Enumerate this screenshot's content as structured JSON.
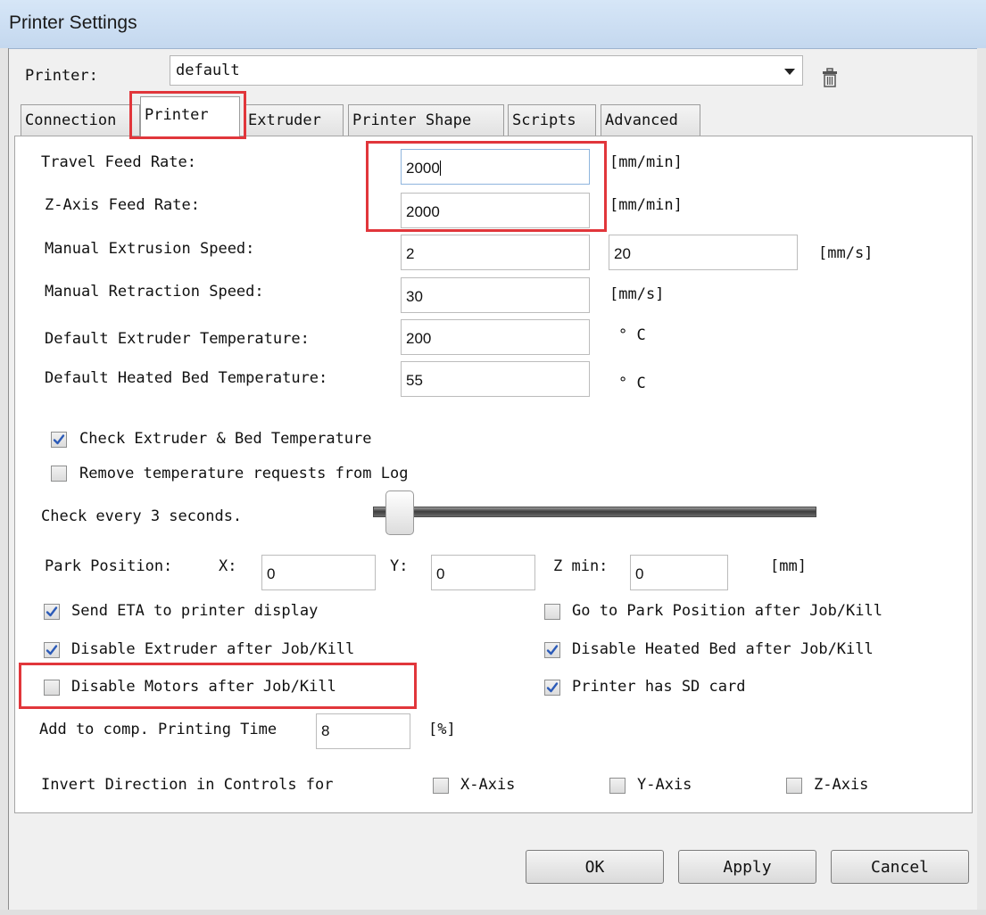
{
  "window": {
    "title": "Printer Settings"
  },
  "printer_row": {
    "label": "Printer:",
    "selected": "default"
  },
  "tabs": [
    {
      "label": "Connection"
    },
    {
      "label": "Printer"
    },
    {
      "label": "Extruder"
    },
    {
      "label": "Printer Shape"
    },
    {
      "label": "Scripts"
    },
    {
      "label": "Advanced"
    }
  ],
  "form": {
    "travel_feed": {
      "label": "Travel Feed Rate:",
      "value": "2000",
      "unit": "[mm/min]"
    },
    "zaxis_feed": {
      "label": "Z-Axis Feed Rate:",
      "value": "2000",
      "unit": "[mm/min]"
    },
    "manual_extrusion": {
      "label": "Manual Extrusion Speed:",
      "value": "2",
      "value2": "20",
      "unit": "[mm/s]"
    },
    "manual_retraction": {
      "label": "Manual Retraction Speed:",
      "value": "30",
      "unit": "[mm/s]"
    },
    "extruder_temp": {
      "label": "Default Extruder Temperature:",
      "value": "200",
      "unit": "° C"
    },
    "bed_temp": {
      "label": "Default Heated Bed Temperature:",
      "value": "55",
      "unit": "° C"
    },
    "check_temp": {
      "label": "Check Extruder & Bed Temperature",
      "checked": true
    },
    "remove_temp": {
      "label": "Remove temperature requests from Log",
      "checked": false
    },
    "check_every": {
      "label": "Check every 3 seconds.",
      "slider_fraction": 0.03
    },
    "park": {
      "label": "Park Position:",
      "x_label": "X:",
      "x": "0",
      "y_label": "Y:",
      "y": "0",
      "zmin_label": "Z min:",
      "zmin": "0",
      "unit": "[mm]"
    },
    "send_eta": {
      "label": "Send ETA to printer display",
      "checked": true
    },
    "go_park": {
      "label": "Go to Park Position after Job/Kill",
      "checked": false
    },
    "disable_extruder": {
      "label": "Disable Extruder after Job/Kill",
      "checked": true
    },
    "disable_bed": {
      "label": "Disable Heated Bed after Job/Kill",
      "checked": true
    },
    "disable_motors": {
      "label": "Disable Motors after Job/Kill",
      "checked": false
    },
    "has_sd": {
      "label": "Printer has SD card",
      "checked": true
    },
    "add_time": {
      "label": "Add to comp. Printing Time",
      "value": "8",
      "unit": "[%]"
    },
    "invert": {
      "label": "Invert Direction in Controls for",
      "x": "X-Axis",
      "y": "Y-Axis",
      "z": "Z-Axis"
    }
  },
  "buttons": {
    "ok": "OK",
    "apply": "Apply",
    "cancel": "Cancel"
  },
  "colors": {
    "highlight": "#e1363b",
    "check": "#2c5bb8"
  }
}
